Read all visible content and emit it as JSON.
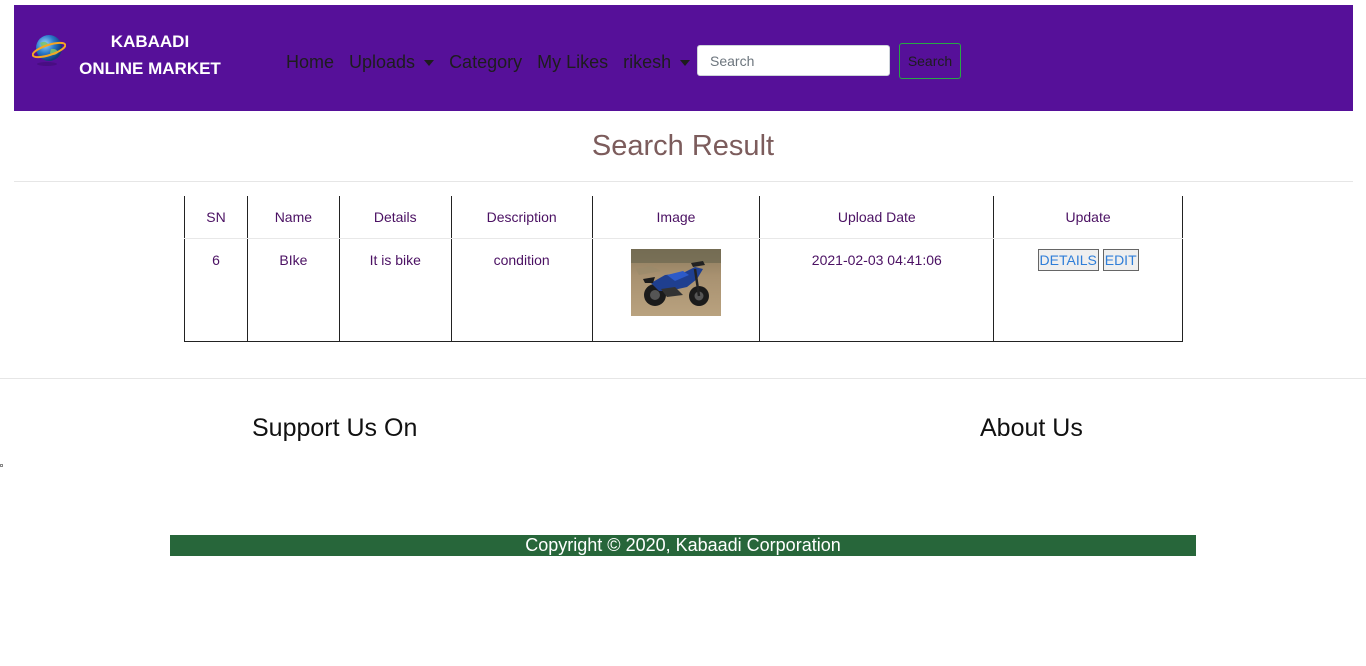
{
  "brand": {
    "line1": "KABAADI",
    "line2": "ONLINE MARKET",
    "logo_icon": "globe-icon"
  },
  "nav": {
    "home": "Home",
    "uploads": "Uploads",
    "category": "Category",
    "my_likes": "My Likes",
    "user": "rikesh"
  },
  "search": {
    "placeholder": "Search",
    "value": "",
    "button": "Search"
  },
  "title": "Search Result",
  "table": {
    "headers": [
      "SN",
      "Name",
      "Details",
      "Description",
      "Image",
      "Upload Date",
      "Update"
    ],
    "rows": [
      {
        "sn": "6",
        "name": "BIke",
        "details": "It is bike",
        "description": "condition",
        "image": "motorbike-photo",
        "upload_date": "2021-02-03 04:41:06",
        "details_button": "DETAILS",
        "edit_button": "EDIT"
      }
    ]
  },
  "footer": {
    "support": "Support Us On",
    "about": "About Us",
    "copyright": "Copyright © 2020, Kabaadi Corporation"
  },
  "colors": {
    "navbar": "#561099",
    "footer_bar": "#27663a",
    "title": "#7c5c5c",
    "table_text": "#4b1163"
  }
}
